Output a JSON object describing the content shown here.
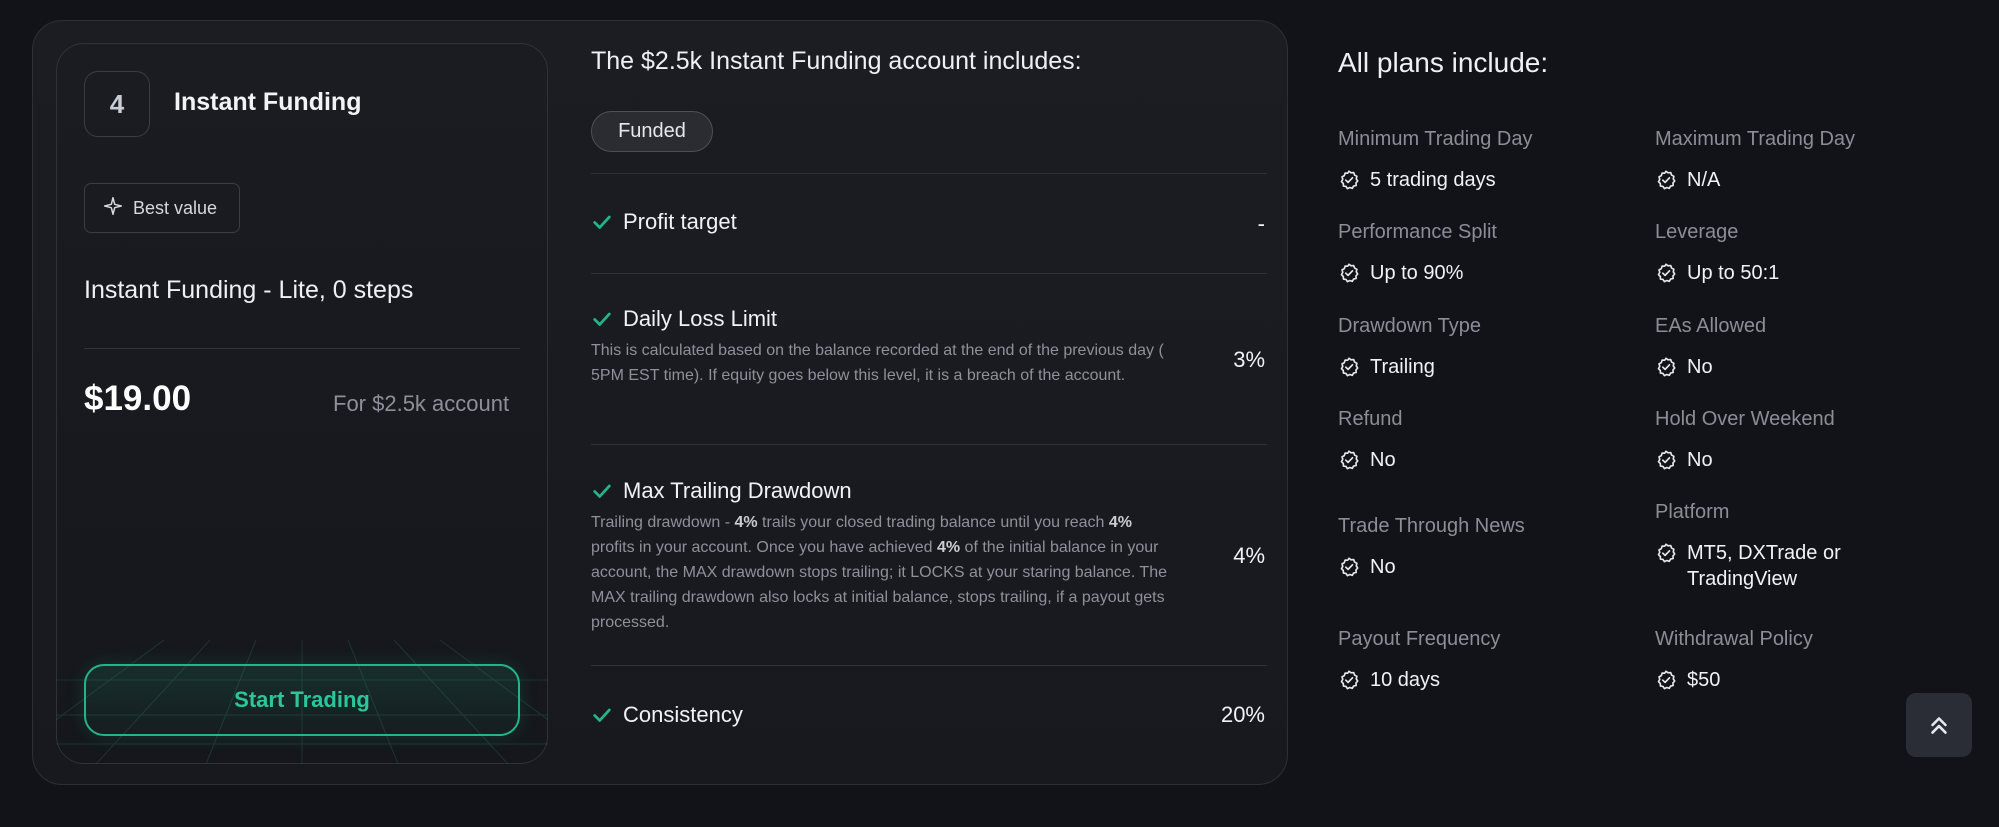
{
  "plan": {
    "number": "4",
    "name": "Instant Funding",
    "badge": "Best value",
    "description": "Instant Funding - Lite, 0 steps",
    "price": "$19.00",
    "price_note": "For $2.5k account",
    "cta": "Start Trading"
  },
  "includes": {
    "title": "The $2.5k Instant Funding account includes:",
    "pill": "Funded",
    "rows": [
      {
        "title": "Profit target",
        "value": "-",
        "description": ""
      },
      {
        "title": "Daily Loss Limit",
        "value": "3%",
        "description": "This is calculated based on the balance recorded at the end of the previous day ( 5PM EST time). If equity goes below this level, it is a breach of the account."
      },
      {
        "title": "Max Trailing Drawdown",
        "value": "4%",
        "description_parts": [
          "Trailing drawdown - ",
          "4%",
          " trails your closed trading balance until you reach ",
          "4%",
          " profits in your account. Once you have achieved ",
          "4%",
          " of the initial balance in your account, the MAX drawdown stops trailing; it LOCKS at your staring balance. The MAX trailing drawdown also locks at initial balance, stops trailing, if a payout gets processed."
        ]
      },
      {
        "title": "Consistency",
        "value": "20%",
        "description": ""
      }
    ]
  },
  "all_plans": {
    "title": "All plans include:",
    "features": [
      {
        "label": "Minimum Trading Day",
        "value": "5 trading days"
      },
      {
        "label": "Maximum Trading Day",
        "value": "N/A"
      },
      {
        "label": "Performance Split",
        "value": "Up to 90%"
      },
      {
        "label": "Leverage",
        "value": "Up to 50:1"
      },
      {
        "label": "Drawdown Type",
        "value": "Trailing"
      },
      {
        "label": "EAs Allowed",
        "value": "No"
      },
      {
        "label": "Refund",
        "value": "No"
      },
      {
        "label": "Hold Over Weekend",
        "value": "No"
      },
      {
        "label": "Trade Through News",
        "value": "No"
      },
      {
        "label": "Platform",
        "value": "MT5, DXTrade or TradingView"
      },
      {
        "label": "Payout Frequency",
        "value": "10 days"
      },
      {
        "label": "Withdrawal Policy",
        "value": "$50"
      }
    ]
  },
  "colors": {
    "accent": "#23b58a",
    "background": "#121318"
  },
  "icons": {
    "badge": "sparkle-icon",
    "check": "check-icon",
    "feature": "check-circle-icon",
    "scroll": "double-chevron-up-icon"
  }
}
